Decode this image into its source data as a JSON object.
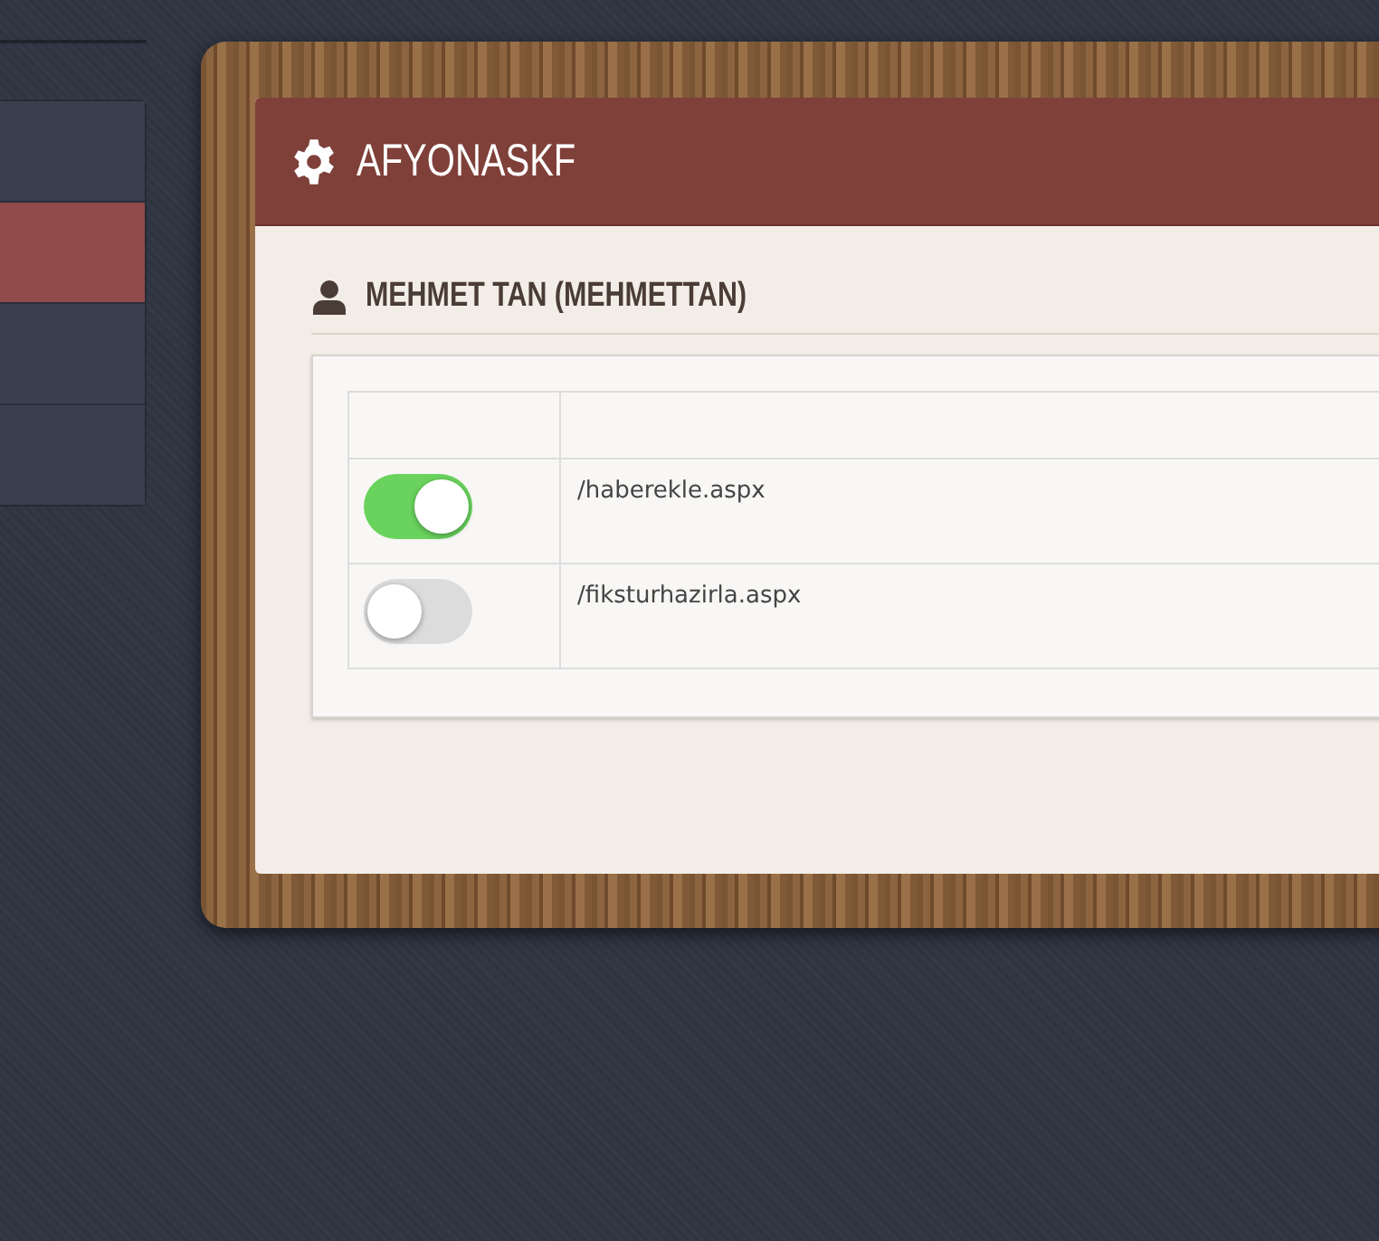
{
  "sidebar": {
    "items": [
      {
        "selected": false
      },
      {
        "selected": true
      },
      {
        "selected": false
      },
      {
        "selected": false
      }
    ]
  },
  "panel": {
    "title": "AFYONASKF",
    "user_heading": "MEHMET TAN (MEHMETTAN)"
  },
  "table": {
    "rows": [
      {
        "enabled": true,
        "page": "/haberekle.aspx"
      },
      {
        "enabled": false,
        "page": "/fiksturhazirla.aspx"
      }
    ]
  }
}
